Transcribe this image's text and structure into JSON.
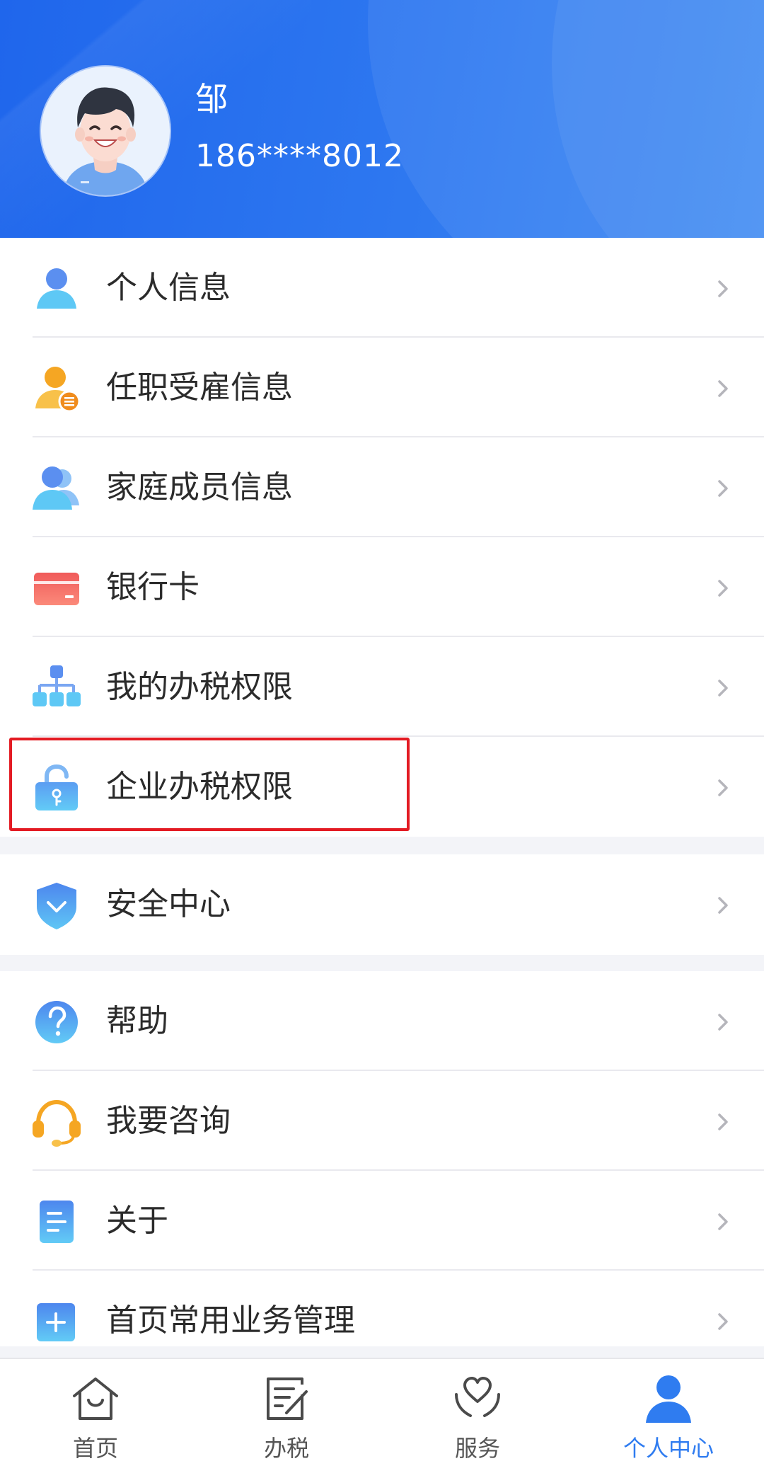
{
  "colors": {
    "header_start": "#1f66ec",
    "header_end": "#3d89f3",
    "accent": "#2f7cf0",
    "highlight_border": "#e31b23",
    "text": "#2b2b2b"
  },
  "profile": {
    "name": "邹",
    "phone": "186****8012"
  },
  "menu_groups": [
    {
      "items": [
        {
          "label": "个人信息",
          "icon": "person-icon"
        },
        {
          "label": "任职受雇信息",
          "icon": "employment-icon"
        },
        {
          "label": "家庭成员信息",
          "icon": "family-icon"
        },
        {
          "label": "银行卡",
          "icon": "bank-card-icon"
        },
        {
          "label": "我的办税权限",
          "icon": "org-chart-icon"
        },
        {
          "label": "企业办税权限",
          "icon": "lock-icon",
          "highlighted": true
        }
      ]
    },
    {
      "items": [
        {
          "label": "安全中心",
          "icon": "shield-icon"
        }
      ]
    },
    {
      "items": [
        {
          "label": "帮助",
          "icon": "help-icon"
        },
        {
          "label": "我要咨询",
          "icon": "headset-icon"
        },
        {
          "label": "关于",
          "icon": "document-icon"
        },
        {
          "label": "首页常用业务管理",
          "icon": "plus-icon"
        }
      ]
    }
  ],
  "tabbar": {
    "tabs": [
      {
        "label": "首页",
        "icon": "home-icon",
        "active": false
      },
      {
        "label": "办税",
        "icon": "tax-form-icon",
        "active": false
      },
      {
        "label": "服务",
        "icon": "service-heart-icon",
        "active": false
      },
      {
        "label": "个人中心",
        "icon": "profile-icon",
        "active": true
      }
    ]
  }
}
